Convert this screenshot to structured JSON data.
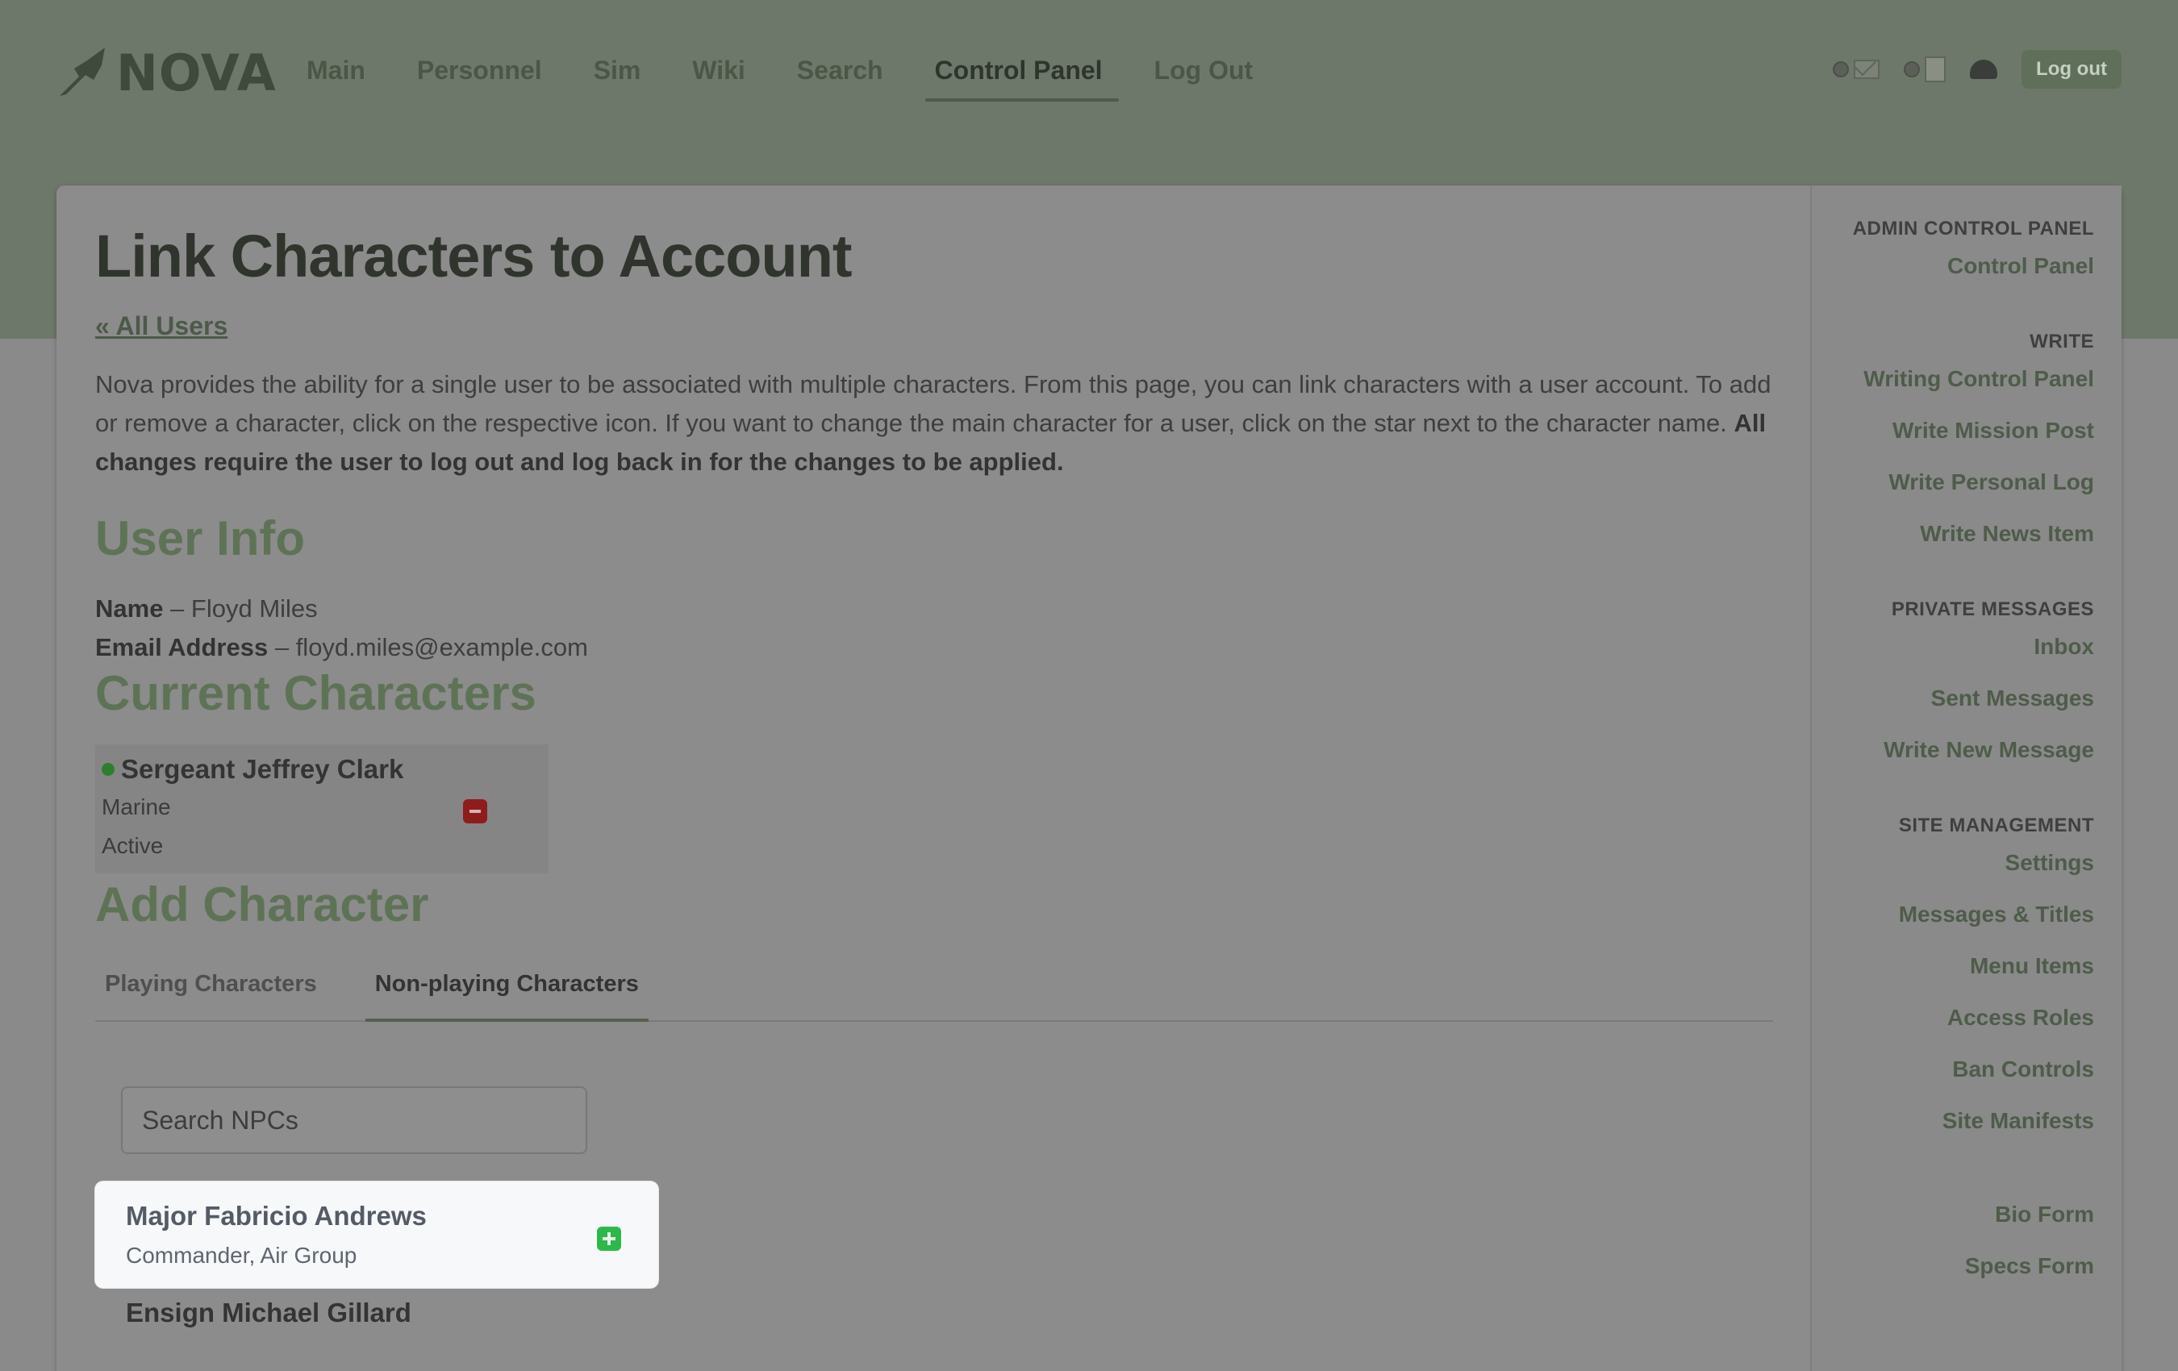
{
  "brand": {
    "name": "NOVA"
  },
  "nav": {
    "items": [
      {
        "label": "Main"
      },
      {
        "label": "Personnel"
      },
      {
        "label": "Sim"
      },
      {
        "label": "Wiki"
      },
      {
        "label": "Search"
      },
      {
        "label": "Control Panel",
        "active": true
      },
      {
        "label": "Log Out"
      }
    ],
    "logout_button": "Log out"
  },
  "page": {
    "title": "Link Characters to Account",
    "back_link": "« All Users",
    "intro": "Nova provides the ability for a single user to be associated with multiple characters. From this page, you can link characters with a user account. To add or remove a character, click on the respective icon. If you want to change the main character for a user, click on the star next to the character name.",
    "intro_bold": "All changes require the user to log out and log back in for the changes to be applied.",
    "user_info_heading": "User Info",
    "user": {
      "name_label": "Name",
      "name": "Floyd Miles",
      "email_label": "Email Address",
      "email": "floyd.miles@example.com"
    },
    "current_heading": "Current Characters",
    "current_characters": [
      {
        "name": "Sergeant Jeffrey Clark",
        "position": "Marine",
        "status": "Active"
      }
    ],
    "add_heading": "Add Character",
    "tabs": [
      {
        "label": "Playing Characters"
      },
      {
        "label": "Non-playing Characters",
        "active": true
      }
    ],
    "search_placeholder": "Search NPCs",
    "npcs": [
      {
        "name": "Major Fabricio Andrews",
        "position": "Commander, Air Group"
      },
      {
        "name": "Ensign Michael Gillard",
        "position": ""
      }
    ]
  },
  "sidebar": {
    "sections": [
      {
        "heading": "ADMIN CONTROL PANEL",
        "items": [
          "Control Panel"
        ]
      },
      {
        "heading": "WRITE",
        "items": [
          "Writing Control Panel",
          "Write Mission Post",
          "Write Personal Log",
          "Write News Item"
        ]
      },
      {
        "heading": "PRIVATE MESSAGES",
        "items": [
          "Inbox",
          "Sent Messages",
          "Write New Message"
        ]
      },
      {
        "heading": "SITE MANAGEMENT",
        "items": [
          "Settings",
          "Messages & Titles",
          "Menu Items",
          "Access Roles",
          "Ban Controls",
          "Site Manifests"
        ]
      },
      {
        "heading": "",
        "items": [
          "Bio Form",
          "Specs Form"
        ]
      }
    ]
  },
  "colors": {
    "header_band": "#6e786a",
    "accent_green": "#5e7356",
    "add_icon": "#2db84a",
    "remove_icon": "#8f1c1c"
  },
  "icons": [
    "nova-logo-icon",
    "mail-icon",
    "note-icon",
    "helmet-icon",
    "status-dot-icon",
    "remove-icon",
    "add-icon"
  ]
}
